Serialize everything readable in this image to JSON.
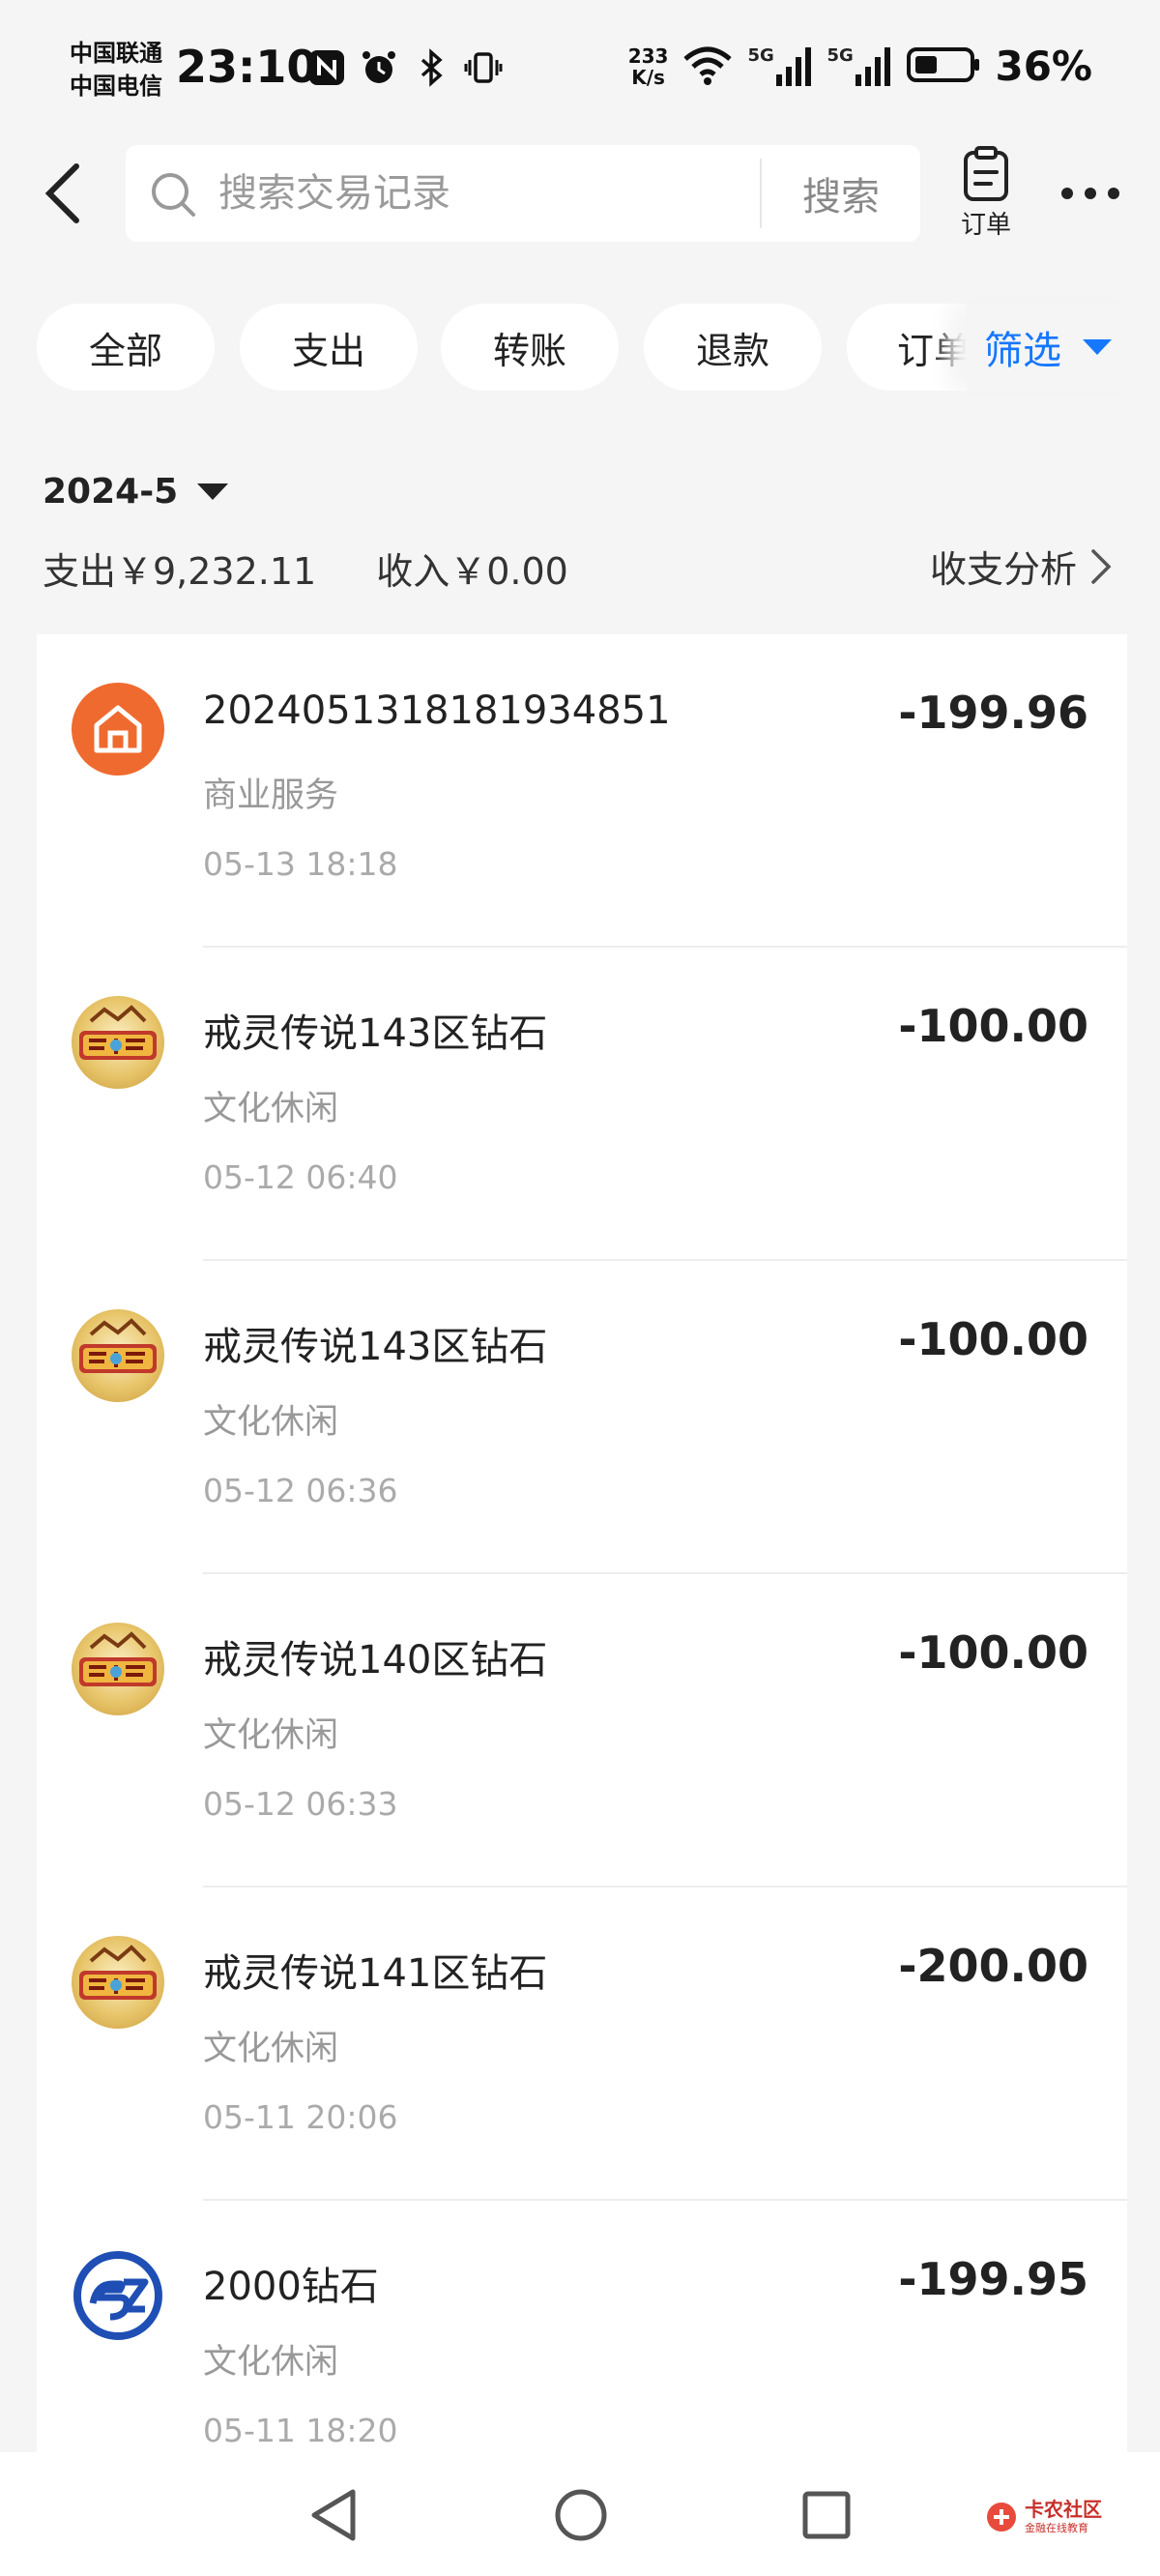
{
  "status_bar": {
    "carrier_1": "中国联通",
    "carrier_2": "中国电信",
    "time": "23:10",
    "net_speed_value": "233",
    "net_speed_unit": "K/s",
    "signal_1_label": "5G",
    "signal_2_label": "5G",
    "battery": "36%"
  },
  "header": {
    "search_placeholder": "搜索交易记录",
    "search_button": "搜索",
    "order_label": "订单"
  },
  "chips": [
    "全部",
    "支出",
    "转账",
    "退款",
    "订单"
  ],
  "filter_label": "筛选",
  "accent_color": "#1677ff",
  "month": "2024-5",
  "summary": {
    "expense": "支出￥9,232.11",
    "income": "收入￥0.00",
    "analysis": "收支分析"
  },
  "transactions": [
    {
      "title": "202405131818193485​1",
      "category": "商业服务",
      "time": "05-13 18:18",
      "amount": "-199.96",
      "icon": "house-icon"
    },
    {
      "title": "戒灵传说143区钻石",
      "category": "文化休闲",
      "time": "05-12 06:40",
      "amount": "-100.00",
      "icon": "game-logo-icon"
    },
    {
      "title": "戒灵传说143区钻石",
      "category": "文化休闲",
      "time": "05-12 06:36",
      "amount": "-100.00",
      "icon": "game-logo-icon"
    },
    {
      "title": "戒灵传说140区钻石",
      "category": "文化休闲",
      "time": "05-12 06:33",
      "amount": "-100.00",
      "icon": "game-logo-icon"
    },
    {
      "title": "戒灵传说141区钻石",
      "category": "文化休闲",
      "time": "05-11 20:06",
      "amount": "-200.00",
      "icon": "game-logo-icon"
    },
    {
      "title": "2000钻石",
      "category": "文化休闲",
      "time": "05-11 18:20",
      "amount": "-199.95",
      "icon": "sz-logo-icon"
    }
  ],
  "watermark": {
    "name": "卡农社区",
    "sub": "金融在线教育"
  }
}
